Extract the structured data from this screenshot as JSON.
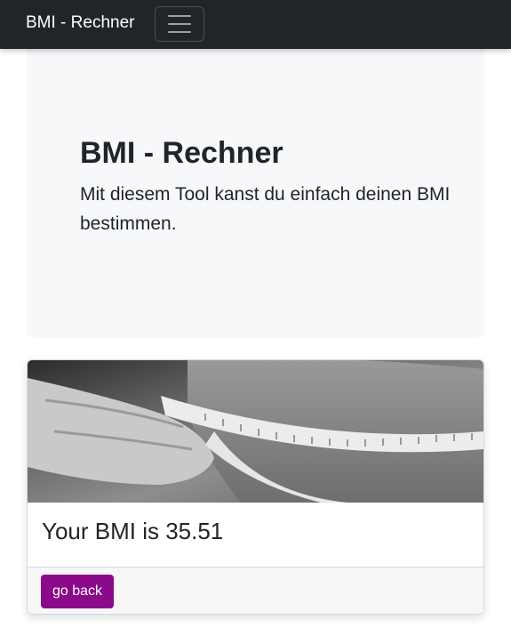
{
  "navbar": {
    "brand": "BMI - Rechner",
    "toggler_icon": "hamburger-menu-icon"
  },
  "hero": {
    "title": "BMI - Rechner",
    "lead": "Mit diesem Tool kanst du einfach deinen BMI bestimmen."
  },
  "result_card": {
    "image": "measuring-tape-waist-photo",
    "title": "Your BMI is 35.51",
    "back_label": "go back"
  },
  "colors": {
    "navbar_bg": "#212529",
    "hero_bg": "#f7f8fa",
    "button_bg": "#8a0a8a"
  }
}
